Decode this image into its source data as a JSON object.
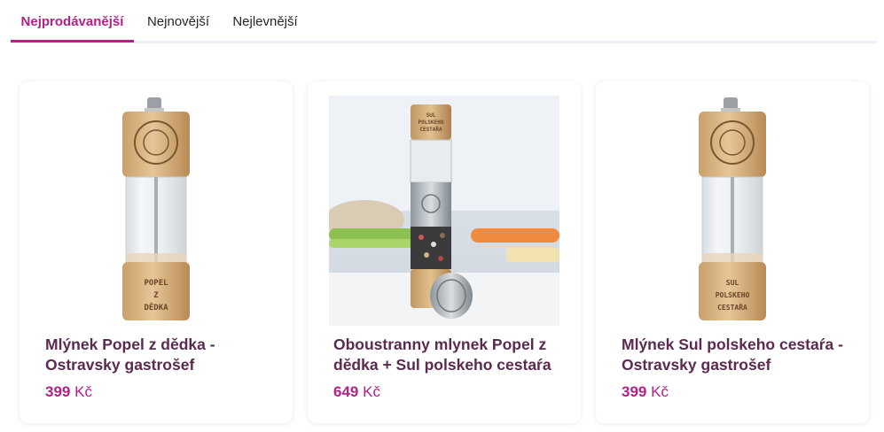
{
  "tabs": [
    {
      "label": "Nejprodávanější",
      "active": true
    },
    {
      "label": "Nejnovější",
      "active": false
    },
    {
      "label": "Nejlevnější",
      "active": false
    }
  ],
  "colors": {
    "accent": "#b51f87",
    "title": "#5a2a4f",
    "tab_underline_track": "#f1eef8"
  },
  "products": [
    {
      "title": "Mlýnek Popel z dědka - Ostravsky gastrošef",
      "price_amount": "399",
      "currency": "Kč",
      "image_icon": "salt-mill-icon",
      "engraving": [
        "POPEL",
        "Z",
        "DĚDKA"
      ]
    },
    {
      "title": "Oboustranny mlynek Popel z dědka + Sul polskeho cestaŕa",
      "price_amount": "649",
      "currency": "Kč",
      "image_icon": "double-mill-photo",
      "engraving": [
        "SUL",
        "POLSKEHO",
        "CESTAŘA"
      ]
    },
    {
      "title": "Mlýnek Sul polskeho cestaŕa - Ostravsky gastrošef",
      "price_amount": "399",
      "currency": "Kč",
      "image_icon": "salt-mill-icon",
      "engraving": [
        "SUL",
        "POLSKEHO",
        "CESTAŘA"
      ]
    }
  ]
}
